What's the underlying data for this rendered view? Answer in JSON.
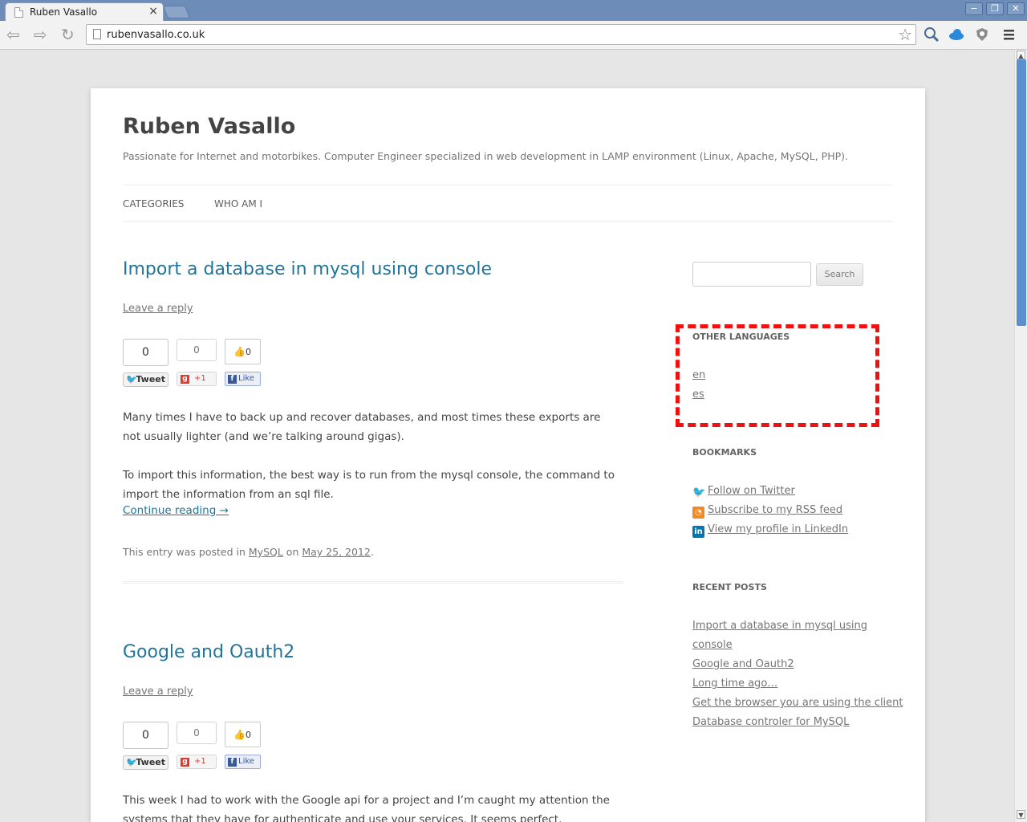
{
  "browser": {
    "tab_title": "Ruben Vasallo",
    "tab_close": "×",
    "url": "rubenvasallo.co.uk",
    "window_minimize": "−",
    "window_restore": "❐",
    "window_close": "✕"
  },
  "site": {
    "title": "Ruben Vasallo",
    "description": "Passionate for Internet and motorbikes. Computer Engineer specialized in web development in LAMP environment (Linux, Apache, MySQL, PHP).",
    "menu": [
      "CATEGORIES",
      "WHO AM I"
    ]
  },
  "posts": [
    {
      "title": "Import a database in mysql using console",
      "reply": "Leave a reply",
      "social": {
        "tweet_count": "0",
        "tweet_label": "Tweet",
        "gplus_count": "0",
        "gplus_label": "+1",
        "fb_count": "0",
        "fb_label": "Like"
      },
      "paragraphs": [
        "Many times I have to back up and recover databases, and most times these exports are not usually lighter (and we’re talking around gigas).",
        "To import this information, the best way is to run from the mysql console, the command to import the information from an sql file."
      ],
      "continue": "Continue reading →",
      "meta_prefix": "This entry was posted in",
      "category": "MySQL",
      "meta_on": "on",
      "date": "May 25, 2012",
      "meta_end": "."
    },
    {
      "title": "Google and Oauth2",
      "reply": "Leave a reply",
      "social": {
        "tweet_count": "0",
        "tweet_label": "Tweet",
        "gplus_count": "0",
        "gplus_label": "+1",
        "fb_count": "0",
        "fb_label": "Like"
      },
      "paragraphs": [
        "This week I had to work with the Google api for a project and I’m caught my attention the systems that they have for authenticate and use your services. It seems perfect. Unfortunately"
      ]
    }
  ],
  "sidebar": {
    "search_placeholder": "",
    "search_button": "Search",
    "languages_title": "OTHER LANGUAGES",
    "languages": [
      "en",
      "es"
    ],
    "bookmarks_title": "BOOKMARKS",
    "bookmarks": [
      "Follow on Twitter",
      "Subscribe to my RSS feed",
      "View my profile in LinkedIn"
    ],
    "recent_title": "RECENT POSTS",
    "recent": [
      "Import a database in mysql using",
      "console",
      "Google and Oauth2",
      "Long time ago…",
      "Get the browser you are using the client",
      "Database controler for MySQL"
    ]
  },
  "colors": {
    "link": "#21759b",
    "highlight": "#ee1111",
    "chrome": "#6d8db8"
  }
}
